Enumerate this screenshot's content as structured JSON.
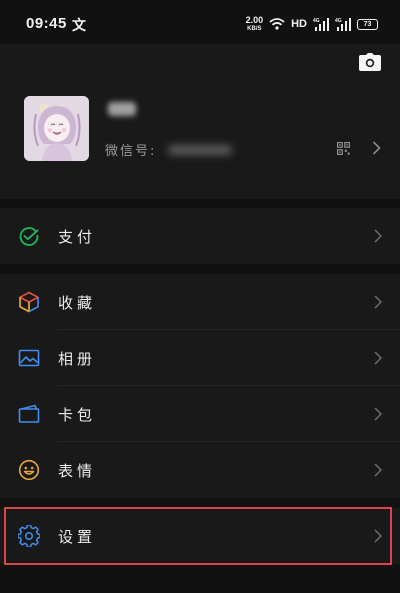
{
  "status_bar": {
    "time": "09:45",
    "app_glyph": "文",
    "net_speed_value": "2.00",
    "net_speed_unit": "KB/S",
    "hd_label": "HD",
    "battery_level": "73"
  },
  "profile": {
    "wechat_id_label": "微信号:",
    "icons": {
      "camera": "camera-icon",
      "qr": "qr-code-icon"
    }
  },
  "menu": {
    "pay": {
      "label": "支付",
      "icon": "wechat-pay-icon",
      "color": "#20b15a"
    },
    "favorites": {
      "label": "收藏",
      "icon": "favorites-cube-icon"
    },
    "album": {
      "label": "相册",
      "icon": "album-icon",
      "color": "#3f8ef1"
    },
    "cards": {
      "label": "卡包",
      "icon": "card-wallet-icon",
      "color": "#3f8ef1"
    },
    "stickers": {
      "label": "表情",
      "icon": "sticker-smiley-icon",
      "color": "#e8a53a"
    },
    "settings": {
      "label": "设置",
      "icon": "gear-icon",
      "color": "#3f8ef1",
      "highlight_color": "#d9434d"
    }
  }
}
